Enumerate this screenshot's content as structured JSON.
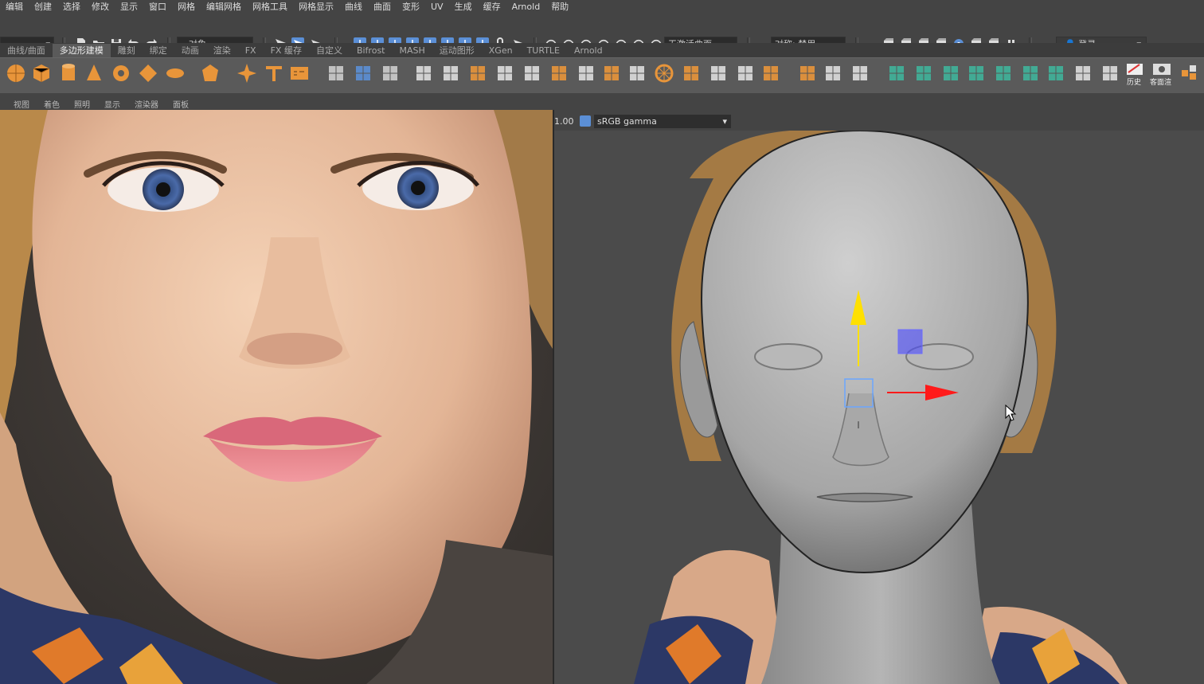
{
  "menus": [
    "编辑",
    "创建",
    "选择",
    "修改",
    "显示",
    "窗口",
    "网格",
    "编辑网格",
    "网格工具",
    "网格显示",
    "曲线",
    "曲面",
    "变形",
    "UV",
    "生成",
    "缓存",
    "Arnold",
    "帮助"
  ],
  "status_line": {
    "select_mode_value": "对象",
    "no_live_surface": "无激活曲面",
    "symmetry": "对称: 禁用",
    "login": "登录"
  },
  "shelf_tabs": [
    {
      "label": "曲线/曲面",
      "active": false
    },
    {
      "label": "多边形建模",
      "active": true
    },
    {
      "label": "雕刻",
      "active": false
    },
    {
      "label": "绑定",
      "active": false
    },
    {
      "label": "动画",
      "active": false
    },
    {
      "label": "渲染",
      "active": false
    },
    {
      "label": "FX",
      "active": false
    },
    {
      "label": "FX 缓存",
      "active": false
    },
    {
      "label": "自定义",
      "active": false
    },
    {
      "label": "Bifrost",
      "active": false
    },
    {
      "label": "MASH",
      "active": false
    },
    {
      "label": "运动图形",
      "active": false
    },
    {
      "label": "XGen",
      "active": false
    },
    {
      "label": "TURTLE",
      "active": false
    },
    {
      "label": "Arnold",
      "active": false
    }
  ],
  "shelf": {
    "history_label": "历史",
    "interactive_label": "客面渲"
  },
  "viewport_menus": [
    "视图",
    "着色",
    "照明",
    "显示",
    "渲染器",
    "面板"
  ],
  "color_mgmt": {
    "gamma_value": "1.00",
    "colorspace": "sRGB gamma"
  },
  "colors": {
    "accent_orange": "#e8953a",
    "accent_blue": "#5b8fd6",
    "accent_green": "#3fb39a",
    "manip_yellow": "#ffe000",
    "manip_red": "#ff1a1a",
    "manip_blue": "#4a4aff"
  }
}
